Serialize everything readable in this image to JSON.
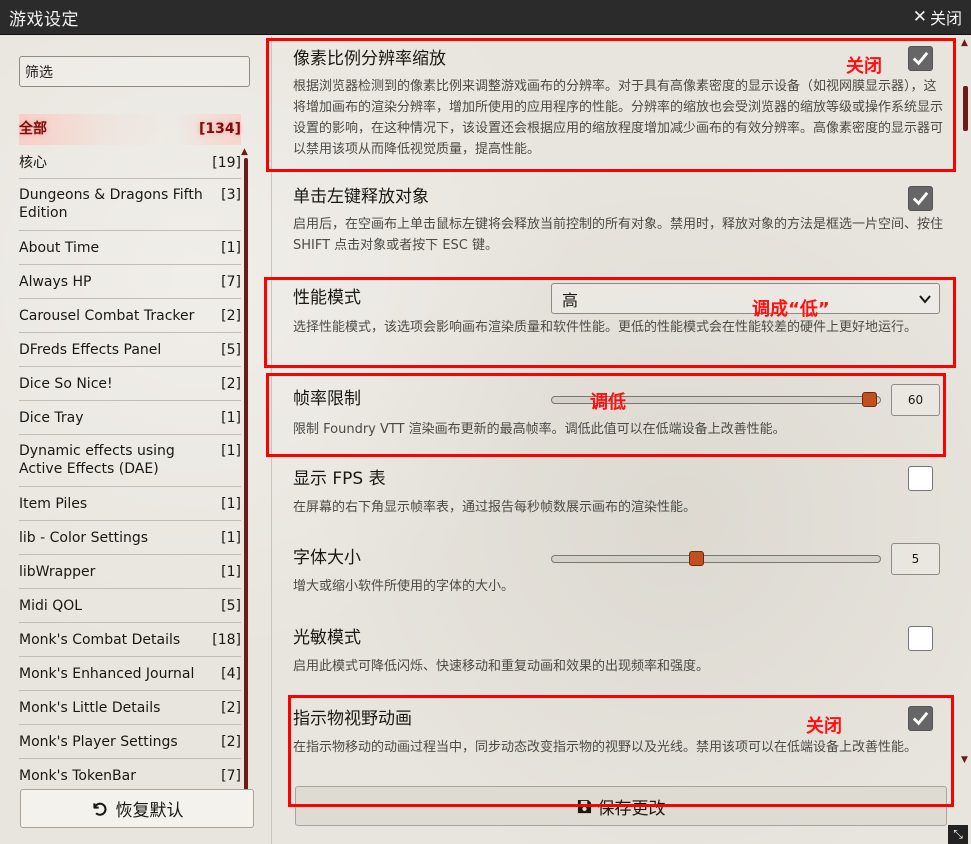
{
  "window": {
    "title": "游戏设定",
    "close_label": "关闭"
  },
  "sidebar": {
    "filter_placeholder": "筛选",
    "categories": [
      {
        "name": "全部",
        "count": "[134]"
      },
      {
        "name": "核心",
        "count": "[19]"
      },
      {
        "name": "Dungeons & Dragons Fifth Edition",
        "count": "[3]"
      },
      {
        "name": "About Time",
        "count": "[1]"
      },
      {
        "name": "Always HP",
        "count": "[7]"
      },
      {
        "name": "Carousel Combat Tracker",
        "count": "[2]"
      },
      {
        "name": "DFreds Effects Panel",
        "count": "[5]"
      },
      {
        "name": "Dice So Nice!",
        "count": "[2]"
      },
      {
        "name": "Dice Tray",
        "count": "[1]"
      },
      {
        "name": "Dynamic effects using Active Effects (DAE)",
        "count": "[1]"
      },
      {
        "name": "Item Piles",
        "count": "[1]"
      },
      {
        "name": "lib - Color Settings",
        "count": "[1]"
      },
      {
        "name": "libWrapper",
        "count": "[1]"
      },
      {
        "name": "Midi QOL",
        "count": "[5]"
      },
      {
        "name": "Monk's Combat Details",
        "count": "[18]"
      },
      {
        "name": "Monk's Enhanced Journal",
        "count": "[4]"
      },
      {
        "name": "Monk's Little Details",
        "count": "[2]"
      },
      {
        "name": "Monk's Player Settings",
        "count": "[2]"
      },
      {
        "name": "Monk's TokenBar",
        "count": "[7]"
      }
    ],
    "reset_label": "恢复默认"
  },
  "settings": {
    "pixel_ratio": {
      "title": "像素比例分辨率缩放",
      "desc": "根据浏览器检测到的像素比例来调整游戏画布的分辨率。对于具有高像素密度的显示设备（如视网膜显示器），这将增加画布的渲染分辨率，增加所使用的应用程序的性能。分辨率的缩放也会受浏览器的缩放等级或操作系统显示设置的影响，在这种情况下，该设置还会根据应用的缩放程度增加减少画布的有效分辨率。高像素密度的显示器可以禁用该项从而降低视觉质量，提高性能。",
      "checked": true
    },
    "left_click_release": {
      "title": "单击左键释放对象",
      "desc": "启用后，在空画布上单击鼠标左键将会释放当前控制的所有对象。禁用时，释放对象的方法是框选一片空间、按住 SHIFT 点击对象或者按下 ESC 键。",
      "checked": true
    },
    "performance_mode": {
      "title": "性能模式",
      "value": "高",
      "desc": "选择性能模式，该选项会影响画布渲染质量和软件性能。更低的性能模式会在性能较差的硬件上更好地运行。"
    },
    "fps_limit": {
      "title": "帧率限制",
      "value": "60",
      "fraction": 1.0,
      "desc": "限制 Foundry VTT 渲染画布更新的最高帧率。调低此值可以在低端设备上改善性能。"
    },
    "show_fps": {
      "title": "显示 FPS 表",
      "desc": "在屏幕的右下角显示帧率表，通过报告每秒帧数展示画布的渲染性能。",
      "checked": false
    },
    "font_size": {
      "title": "字体大小",
      "value": "5",
      "fraction": 0.45,
      "desc": "增大或缩小软件所使用的字体的大小。"
    },
    "photosensitive": {
      "title": "光敏模式",
      "desc": "启用此模式可降低闪烁、快速移动和重复动画和效果的出现频率和强度。",
      "checked": false
    },
    "vision_animation": {
      "title": "指示物视野动画",
      "desc": "在指示物移动的动画过程当中，同步动态改变指示物的视野以及光线。禁用该项可以在低端设备上改善性能。",
      "checked": true
    }
  },
  "save_label": "保存更改",
  "annotations": {
    "close_1": "关闭",
    "set_low": "调成“低”",
    "lower": "调低",
    "close_2": "关闭"
  },
  "colors": {
    "annotation": "#ff0000",
    "accent": "#6f1a1a",
    "slider_thumb": "#c0501e"
  }
}
